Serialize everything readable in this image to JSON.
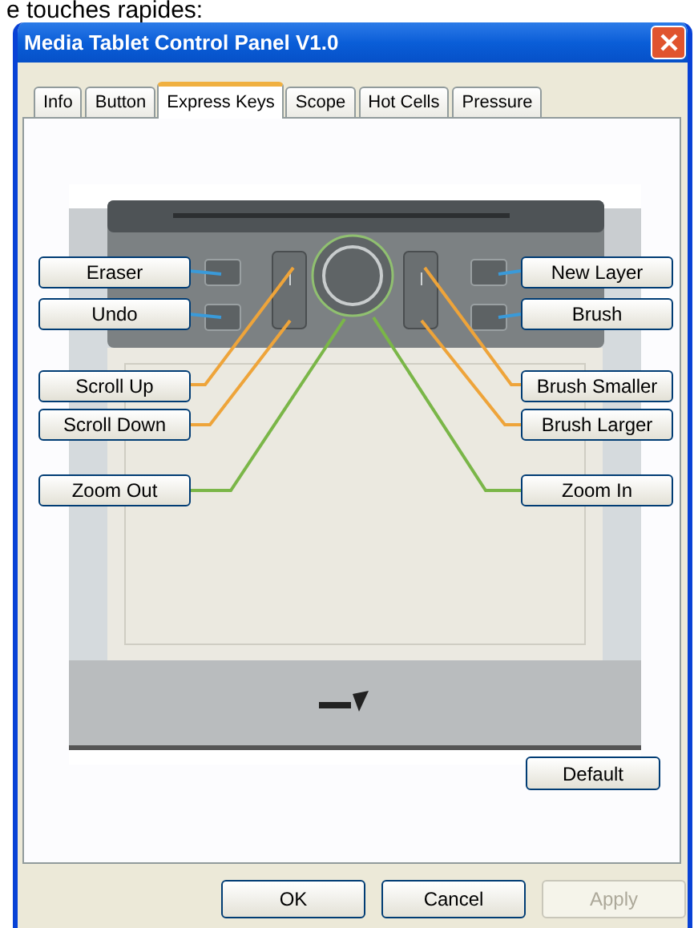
{
  "caption": "e touches rapides:",
  "window": {
    "title": "Media Tablet Control Panel V1.0"
  },
  "tabs": [
    {
      "label": "Info",
      "selected": false
    },
    {
      "label": "Button",
      "selected": false
    },
    {
      "label": "Express Keys",
      "selected": true
    },
    {
      "label": "Scope",
      "selected": false
    },
    {
      "label": "Hot Cells",
      "selected": false
    },
    {
      "label": "Pressure",
      "selected": false
    }
  ],
  "left_keys": [
    {
      "label": "Eraser",
      "color": "#3a9ad9"
    },
    {
      "label": "Undo",
      "color": "#3a9ad9"
    },
    {
      "label": "Scroll Up",
      "color": "#eea43a"
    },
    {
      "label": "Scroll Down",
      "color": "#eea43a"
    },
    {
      "label": "Zoom Out",
      "color": "#7ab648"
    }
  ],
  "right_keys": [
    {
      "label": "New Layer",
      "color": "#3a9ad9"
    },
    {
      "label": "Brush",
      "color": "#3a9ad9"
    },
    {
      "label": "Brush Smaller",
      "color": "#eea43a"
    },
    {
      "label": "Brush Larger",
      "color": "#eea43a"
    },
    {
      "label": "Zoom In",
      "color": "#7ab648"
    }
  ],
  "default_button": "Default",
  "buttons": [
    {
      "label": "OK",
      "disabled": false
    },
    {
      "label": "Cancel",
      "disabled": false
    },
    {
      "label": "Apply",
      "disabled": true
    }
  ]
}
